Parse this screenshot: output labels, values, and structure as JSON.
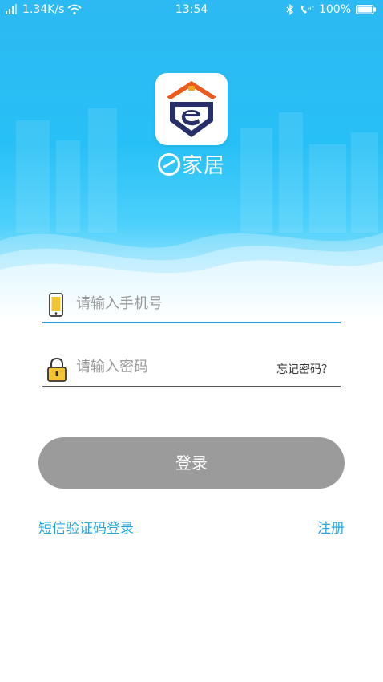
{
  "status_bar": {
    "network_speed": "1.34K/s",
    "time": "13:54",
    "battery": "100%"
  },
  "app": {
    "name": "家居"
  },
  "form": {
    "phone_placeholder": "请输入手机号",
    "password_placeholder": "请输入密码",
    "forgot_password": "忘记密码？",
    "login_label": "登录"
  },
  "links": {
    "sms_login": "短信验证码登录",
    "register": "注册"
  },
  "colors": {
    "accent": "#2aa3de",
    "active_underline": "#2f9ede",
    "inactive_underline": "#555555",
    "login_button": "#9b9b9b"
  }
}
